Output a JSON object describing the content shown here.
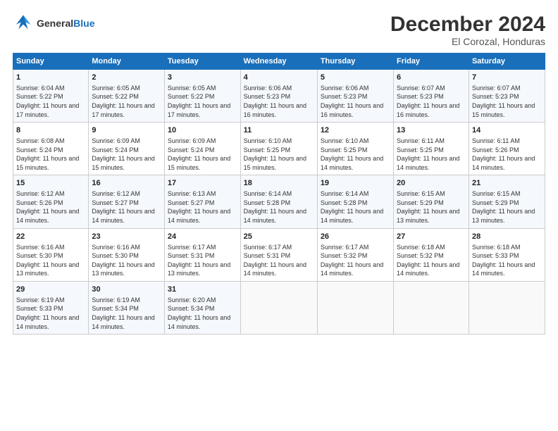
{
  "logo": {
    "line1": "General",
    "line2": "Blue"
  },
  "title": "December 2024",
  "subtitle": "El Corozal, Honduras",
  "weekdays": [
    "Sunday",
    "Monday",
    "Tuesday",
    "Wednesday",
    "Thursday",
    "Friday",
    "Saturday"
  ],
  "weeks": [
    [
      {
        "day": "1",
        "sunrise": "Sunrise: 6:04 AM",
        "sunset": "Sunset: 5:22 PM",
        "daylight": "Daylight: 11 hours and 17 minutes."
      },
      {
        "day": "2",
        "sunrise": "Sunrise: 6:05 AM",
        "sunset": "Sunset: 5:22 PM",
        "daylight": "Daylight: 11 hours and 17 minutes."
      },
      {
        "day": "3",
        "sunrise": "Sunrise: 6:05 AM",
        "sunset": "Sunset: 5:22 PM",
        "daylight": "Daylight: 11 hours and 17 minutes."
      },
      {
        "day": "4",
        "sunrise": "Sunrise: 6:06 AM",
        "sunset": "Sunset: 5:23 PM",
        "daylight": "Daylight: 11 hours and 16 minutes."
      },
      {
        "day": "5",
        "sunrise": "Sunrise: 6:06 AM",
        "sunset": "Sunset: 5:23 PM",
        "daylight": "Daylight: 11 hours and 16 minutes."
      },
      {
        "day": "6",
        "sunrise": "Sunrise: 6:07 AM",
        "sunset": "Sunset: 5:23 PM",
        "daylight": "Daylight: 11 hours and 16 minutes."
      },
      {
        "day": "7",
        "sunrise": "Sunrise: 6:07 AM",
        "sunset": "Sunset: 5:23 PM",
        "daylight": "Daylight: 11 hours and 15 minutes."
      }
    ],
    [
      {
        "day": "8",
        "sunrise": "Sunrise: 6:08 AM",
        "sunset": "Sunset: 5:24 PM",
        "daylight": "Daylight: 11 hours and 15 minutes."
      },
      {
        "day": "9",
        "sunrise": "Sunrise: 6:09 AM",
        "sunset": "Sunset: 5:24 PM",
        "daylight": "Daylight: 11 hours and 15 minutes."
      },
      {
        "day": "10",
        "sunrise": "Sunrise: 6:09 AM",
        "sunset": "Sunset: 5:24 PM",
        "daylight": "Daylight: 11 hours and 15 minutes."
      },
      {
        "day": "11",
        "sunrise": "Sunrise: 6:10 AM",
        "sunset": "Sunset: 5:25 PM",
        "daylight": "Daylight: 11 hours and 15 minutes."
      },
      {
        "day": "12",
        "sunrise": "Sunrise: 6:10 AM",
        "sunset": "Sunset: 5:25 PM",
        "daylight": "Daylight: 11 hours and 14 minutes."
      },
      {
        "day": "13",
        "sunrise": "Sunrise: 6:11 AM",
        "sunset": "Sunset: 5:25 PM",
        "daylight": "Daylight: 11 hours and 14 minutes."
      },
      {
        "day": "14",
        "sunrise": "Sunrise: 6:11 AM",
        "sunset": "Sunset: 5:26 PM",
        "daylight": "Daylight: 11 hours and 14 minutes."
      }
    ],
    [
      {
        "day": "15",
        "sunrise": "Sunrise: 6:12 AM",
        "sunset": "Sunset: 5:26 PM",
        "daylight": "Daylight: 11 hours and 14 minutes."
      },
      {
        "day": "16",
        "sunrise": "Sunrise: 6:12 AM",
        "sunset": "Sunset: 5:27 PM",
        "daylight": "Daylight: 11 hours and 14 minutes."
      },
      {
        "day": "17",
        "sunrise": "Sunrise: 6:13 AM",
        "sunset": "Sunset: 5:27 PM",
        "daylight": "Daylight: 11 hours and 14 minutes."
      },
      {
        "day": "18",
        "sunrise": "Sunrise: 6:14 AM",
        "sunset": "Sunset: 5:28 PM",
        "daylight": "Daylight: 11 hours and 14 minutes."
      },
      {
        "day": "19",
        "sunrise": "Sunrise: 6:14 AM",
        "sunset": "Sunset: 5:28 PM",
        "daylight": "Daylight: 11 hours and 14 minutes."
      },
      {
        "day": "20",
        "sunrise": "Sunrise: 6:15 AM",
        "sunset": "Sunset: 5:29 PM",
        "daylight": "Daylight: 11 hours and 13 minutes."
      },
      {
        "day": "21",
        "sunrise": "Sunrise: 6:15 AM",
        "sunset": "Sunset: 5:29 PM",
        "daylight": "Daylight: 11 hours and 13 minutes."
      }
    ],
    [
      {
        "day": "22",
        "sunrise": "Sunrise: 6:16 AM",
        "sunset": "Sunset: 5:30 PM",
        "daylight": "Daylight: 11 hours and 13 minutes."
      },
      {
        "day": "23",
        "sunrise": "Sunrise: 6:16 AM",
        "sunset": "Sunset: 5:30 PM",
        "daylight": "Daylight: 11 hours and 13 minutes."
      },
      {
        "day": "24",
        "sunrise": "Sunrise: 6:17 AM",
        "sunset": "Sunset: 5:31 PM",
        "daylight": "Daylight: 11 hours and 13 minutes."
      },
      {
        "day": "25",
        "sunrise": "Sunrise: 6:17 AM",
        "sunset": "Sunset: 5:31 PM",
        "daylight": "Daylight: 11 hours and 14 minutes."
      },
      {
        "day": "26",
        "sunrise": "Sunrise: 6:17 AM",
        "sunset": "Sunset: 5:32 PM",
        "daylight": "Daylight: 11 hours and 14 minutes."
      },
      {
        "day": "27",
        "sunrise": "Sunrise: 6:18 AM",
        "sunset": "Sunset: 5:32 PM",
        "daylight": "Daylight: 11 hours and 14 minutes."
      },
      {
        "day": "28",
        "sunrise": "Sunrise: 6:18 AM",
        "sunset": "Sunset: 5:33 PM",
        "daylight": "Daylight: 11 hours and 14 minutes."
      }
    ],
    [
      {
        "day": "29",
        "sunrise": "Sunrise: 6:19 AM",
        "sunset": "Sunset: 5:33 PM",
        "daylight": "Daylight: 11 hours and 14 minutes."
      },
      {
        "day": "30",
        "sunrise": "Sunrise: 6:19 AM",
        "sunset": "Sunset: 5:34 PM",
        "daylight": "Daylight: 11 hours and 14 minutes."
      },
      {
        "day": "31",
        "sunrise": "Sunrise: 6:20 AM",
        "sunset": "Sunset: 5:34 PM",
        "daylight": "Daylight: 11 hours and 14 minutes."
      },
      null,
      null,
      null,
      null
    ]
  ]
}
